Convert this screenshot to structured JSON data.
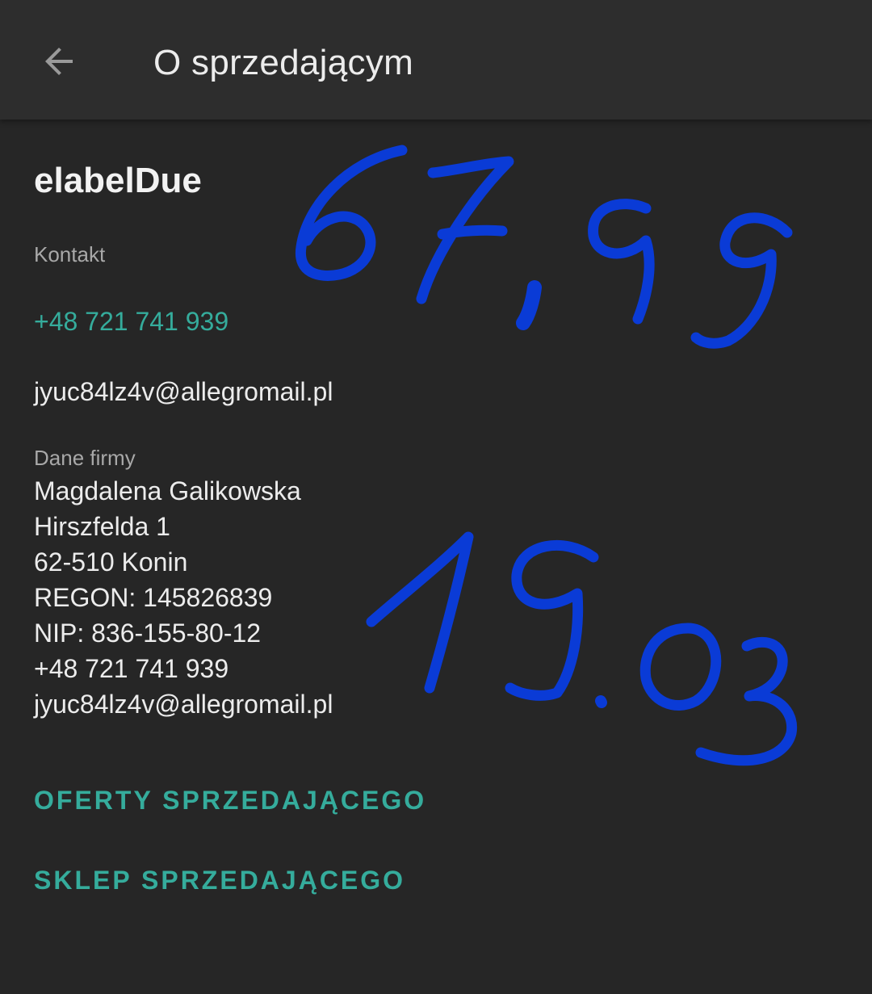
{
  "app_bar": {
    "back_icon": "arrow-back-icon",
    "title": "O sprzedającym"
  },
  "seller": {
    "name": "elabelDue",
    "contact_label": "Kontakt",
    "phone": "+48 721 741 939",
    "email": "jyuc84lz4v@allegromail.pl",
    "company_label": "Dane firmy",
    "company_lines": [
      "Magdalena Galikowska",
      "Hirszfelda 1",
      "62-510 Konin",
      "REGON: 145826839",
      "NIP: 836-155-80-12",
      "+48 721 741 939",
      "jyuc84lz4v@allegromail.pl"
    ]
  },
  "actions": {
    "offers_label": "OFERTY SPRZEDAJĄCEGO",
    "shop_label": "SKLEP SPRZEDAJĄCEGO"
  },
  "handwritten_notes": [
    "67,99",
    "19.03"
  ],
  "colors": {
    "background": "#262626",
    "app_bar": "#2d2d2d",
    "accent": "#35ac9c",
    "ink": "#0a3bd6"
  }
}
